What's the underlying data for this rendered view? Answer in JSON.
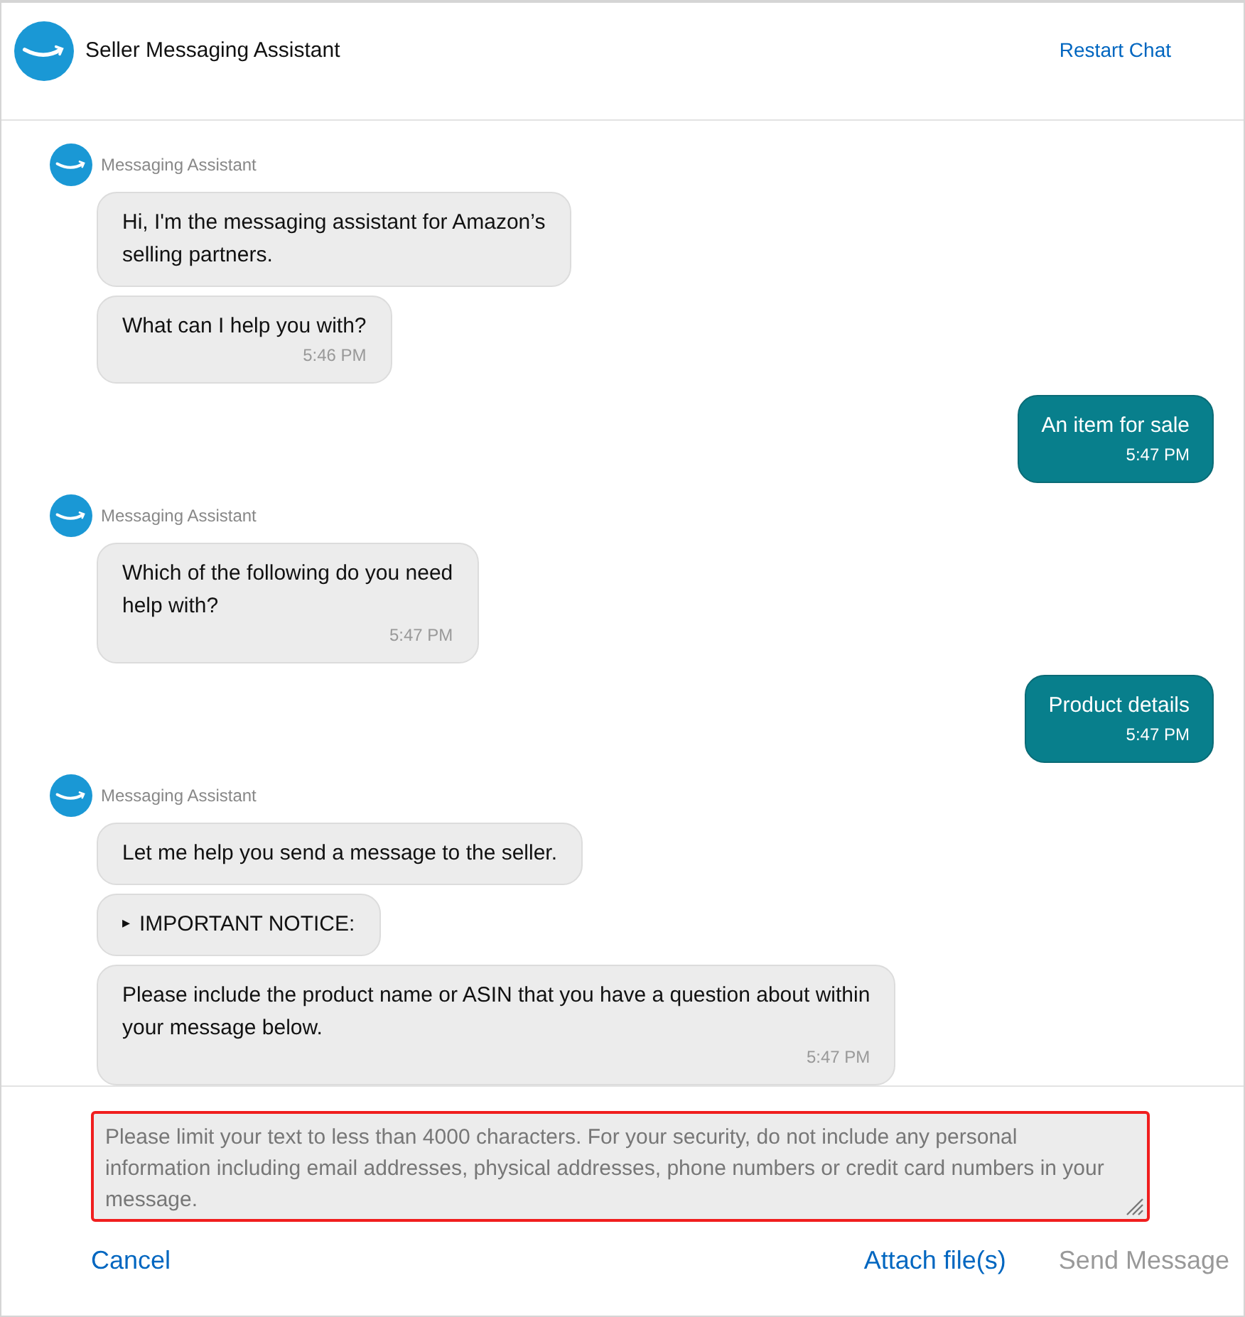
{
  "header": {
    "title": "Seller Messaging Assistant",
    "restart_link": "Restart Chat"
  },
  "messages": [
    {
      "kind": "assistant",
      "sender": "Messaging Assistant",
      "bubbles": [
        {
          "text": "Hi, I'm the messaging assistant for Amazon’s\nselling partners."
        },
        {
          "text": "What can I help you with?",
          "time": "5:46 PM"
        }
      ]
    },
    {
      "kind": "user",
      "bubbles": [
        {
          "text": "An item for sale",
          "time": "5:47 PM"
        }
      ]
    },
    {
      "kind": "assistant",
      "sender": "Messaging Assistant",
      "bubbles": [
        {
          "text": "Which of the following do you need\nhelp with?",
          "time": "5:47 PM"
        }
      ]
    },
    {
      "kind": "user",
      "bubbles": [
        {
          "text": "Product details",
          "time": "5:47 PM"
        }
      ]
    },
    {
      "kind": "assistant",
      "sender": "Messaging Assistant",
      "bubbles": [
        {
          "text": "Let me help you send a message to the seller."
        },
        {
          "text": "IMPORTANT NOTICE:",
          "toggle": "▸",
          "expanded": false
        },
        {
          "text": "Please include the product name or ASIN that you have a question about within\nyour message below.",
          "time": "5:47 PM"
        }
      ]
    }
  ],
  "composer": {
    "placeholder": "Please limit your text to less than 4000 characters. For your security, do not include any personal information including email addresses, physical addresses, phone numbers or credit card numbers in your message.",
    "highlighted": true
  },
  "actions": [
    {
      "label": "Cancel",
      "disabled": false
    },
    {
      "label": "Attach file(s)",
      "disabled": false
    },
    {
      "label": "Send Message",
      "disabled": true
    }
  ]
}
